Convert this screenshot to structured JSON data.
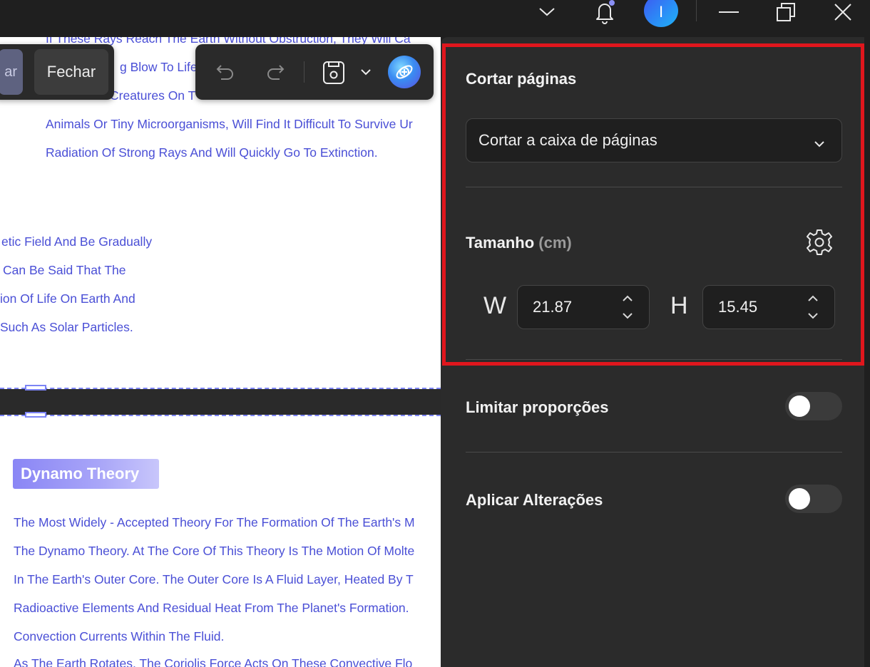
{
  "titlebar": {
    "avatar_initial": "I"
  },
  "toolbar_left": {
    "partial_button_label": "ar",
    "close_label": "Fechar"
  },
  "document": {
    "lines_top": [
      "If These Rays Reach The Earth Without Obstruction, They Will Ca",
      "g Blow To Life",
      "Creatures On T",
      "Animals Or Tiny Microorganisms, Will Find It Difficult To Survive Ur",
      "Radiation Of Strong Rays And Will Quickly Go To Extinction.",
      "etic Field And Be Gradually",
      "Can Be Said That The",
      "ion Of Life On Earth And",
      "Such As Solar Particles."
    ],
    "section_badge": "Dynamo Theory",
    "lines_bottom": [
      "The Most Widely - Accepted Theory For The Formation Of The Earth's M",
      "The Dynamo Theory. At The Core Of This Theory Is The Motion Of Molte",
      "In The Earth's Outer Core. The Outer Core Is A Fluid Layer, Heated By T",
      "Radioactive Elements And Residual Heat From The Planet's Formation.",
      "Convection Currents Within The Fluid.",
      "As The Earth Rotates, The Coriolis Force Acts On These Convective Flo"
    ]
  },
  "panel": {
    "crop_title": "Cortar páginas",
    "crop_mode_selected": "Cortar a caixa de páginas",
    "size_label": "Tamanho",
    "size_unit": "(cm)",
    "width_letter": "W",
    "width_value": "21.87",
    "height_letter": "H",
    "height_value": "15.45",
    "limit_proportions_label": "Limitar proporções",
    "limit_proportions_on": false,
    "apply_changes_label": "Aplicar Alterações",
    "apply_changes_on": false
  },
  "colors": {
    "highlight": "#e0161d",
    "link_text": "#4a4fd6",
    "panel_bg": "#2b2b2b"
  }
}
